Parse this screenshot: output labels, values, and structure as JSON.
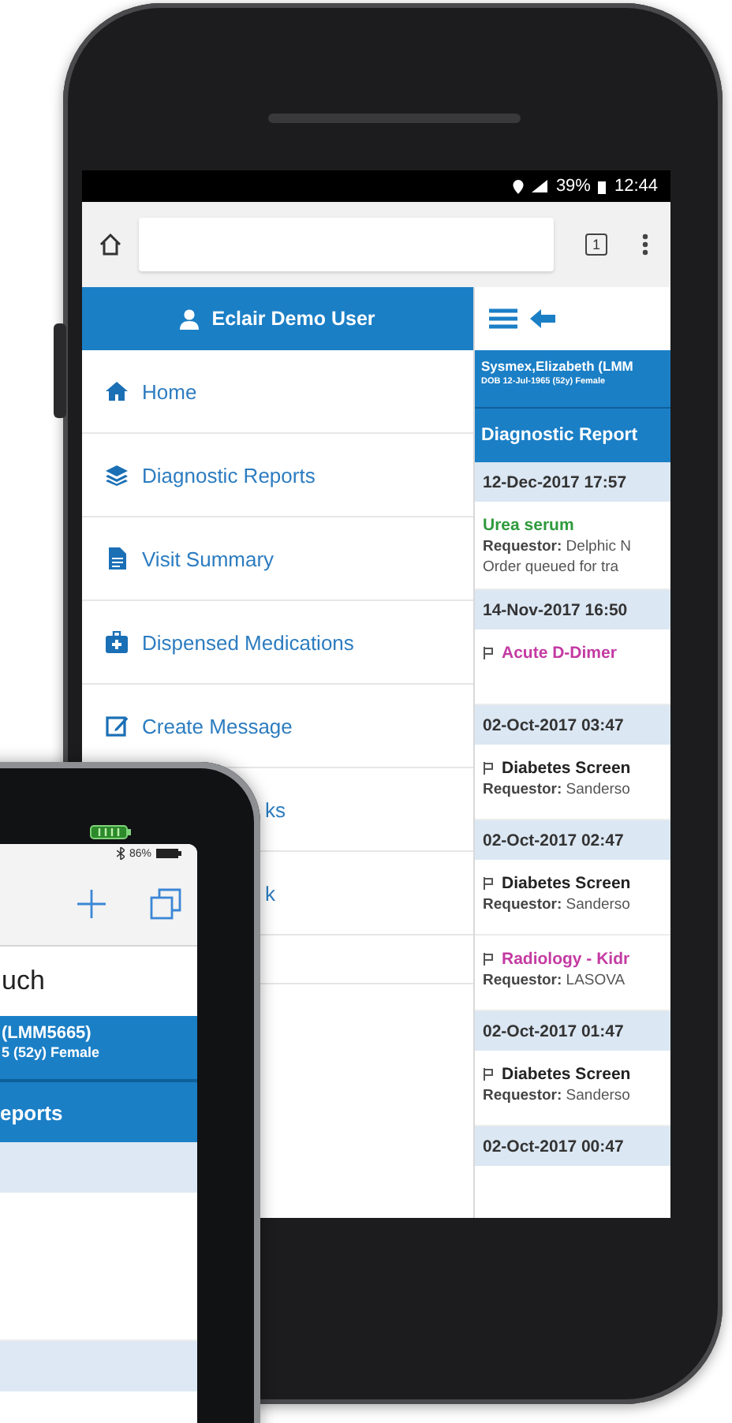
{
  "main_phone": {
    "status_bar": {
      "battery": "39%",
      "time": "12:44"
    },
    "browser_bar": {
      "tab_count": "1"
    },
    "sidebar": {
      "user": "Eclair Demo User",
      "items": [
        {
          "label": "Home",
          "kind": "full"
        },
        {
          "label": "Diagnostic Reports",
          "kind": "full"
        },
        {
          "label": "Visit Summary",
          "kind": "full"
        },
        {
          "label": "Dispensed Medications",
          "kind": "full"
        },
        {
          "label": "Create Message",
          "kind": "full"
        },
        {
          "label": "ks",
          "kind": "covered"
        },
        {
          "label": "k",
          "kind": "covered"
        }
      ]
    },
    "panel": {
      "patient": {
        "name": "Sysmex,Elizabeth (LMM",
        "dob": "DOB 12-Jul-1965 (52y) Female"
      },
      "section_title": "Diagnostic Report",
      "entries": [
        {
          "kind": "date",
          "text": "12-Dec-2017 17:57"
        },
        {
          "kind": "report",
          "title": "Urea serum",
          "color": "#2e9a3c",
          "flagged": false,
          "lines": [
            "**Requestor:** Delphic N",
            "Order queued for tra"
          ]
        },
        {
          "kind": "date",
          "text": "14-Nov-2017 16:50"
        },
        {
          "kind": "report",
          "title": "Acute D-Dimer",
          "color": "#c43aa2",
          "flagged": true
        },
        {
          "kind": "date",
          "text": "02-Oct-2017 03:47"
        },
        {
          "kind": "report",
          "title": "Diabetes Screen",
          "color": "#222222",
          "flagged": true,
          "lines": [
            "**Requestor:** Sanderso"
          ]
        },
        {
          "kind": "date",
          "text": "02-Oct-2017 02:47"
        },
        {
          "kind": "report",
          "title": "Diabetes Screen",
          "color": "#222222",
          "flagged": true,
          "lines": [
            "**Requestor:** Sanderso"
          ]
        },
        {
          "kind": "report",
          "title": "Radiology - Kidr",
          "color": "#c43aa2",
          "flagged": true,
          "lines": [
            "**Requestor:** LASOVA"
          ]
        },
        {
          "kind": "date",
          "text": "02-Oct-2017 01:47"
        },
        {
          "kind": "report",
          "title": "Diabetes Screen",
          "color": "#222222",
          "flagged": true,
          "lines": [
            "**Requestor:** Sanderso"
          ]
        },
        {
          "kind": "date",
          "text": "02-Oct-2017 00:47"
        }
      ]
    }
  },
  "second_phone": {
    "status_bar": {
      "battery": "86%"
    },
    "search_text": "uch",
    "patient": {
      "name": "(LMM5665)",
      "dob": "5 (52y) Female"
    },
    "section_title": "eports"
  }
}
